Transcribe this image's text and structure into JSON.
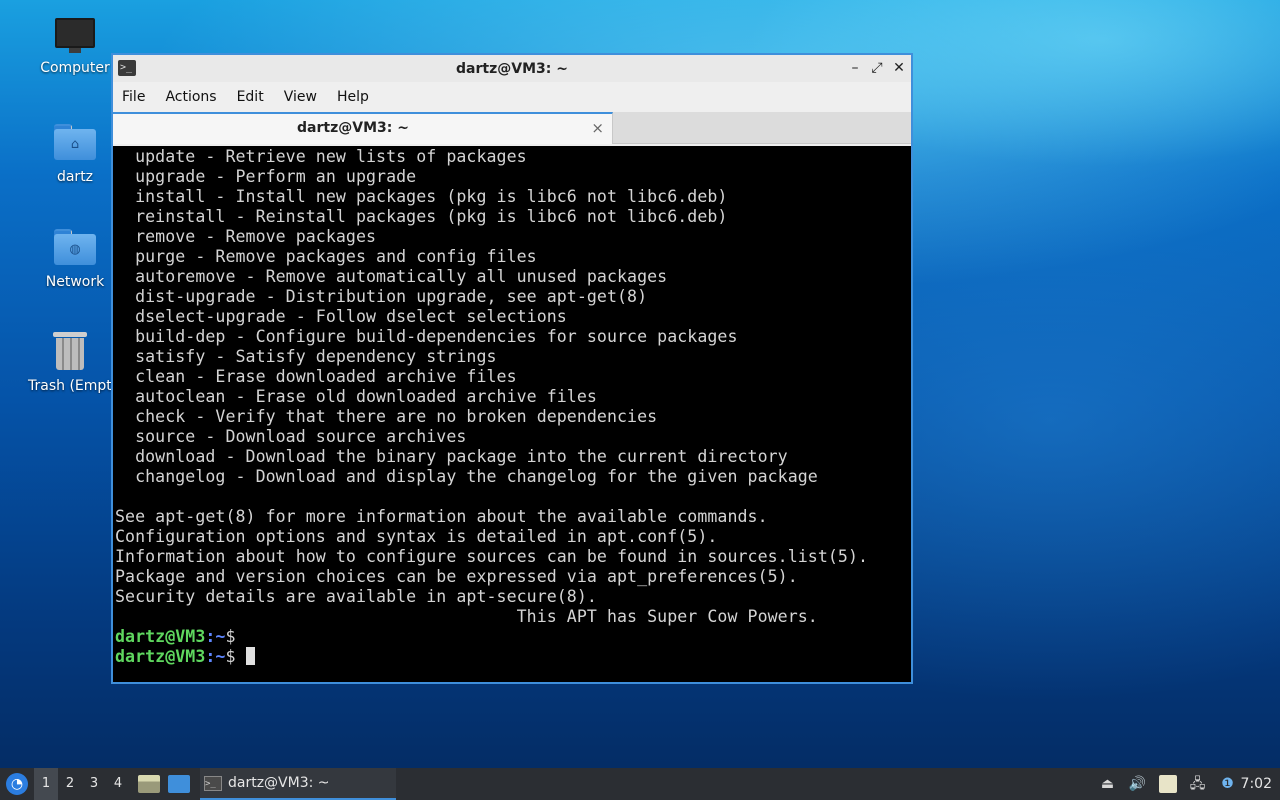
{
  "desktop": {
    "icons": [
      {
        "label": "Computer",
        "icon": "monitor-icon"
      },
      {
        "label": "dartz",
        "icon": "home-folder-icon"
      },
      {
        "label": "Network",
        "icon": "network-folder-icon"
      },
      {
        "label": "Trash (Empt",
        "icon": "trash-icon"
      }
    ]
  },
  "window": {
    "title": "dartz@VM3: ~",
    "menu": [
      "File",
      "Actions",
      "Edit",
      "View",
      "Help"
    ],
    "tab_label": "dartz@VM3: ~",
    "tab_close": "×",
    "controls": {
      "minimize": "–",
      "maximize": "⤢",
      "close": "✕"
    }
  },
  "terminal": {
    "lines": [
      "  update - Retrieve new lists of packages",
      "  upgrade - Perform an upgrade",
      "  install - Install new packages (pkg is libc6 not libc6.deb)",
      "  reinstall - Reinstall packages (pkg is libc6 not libc6.deb)",
      "  remove - Remove packages",
      "  purge - Remove packages and config files",
      "  autoremove - Remove automatically all unused packages",
      "  dist-upgrade - Distribution upgrade, see apt-get(8)",
      "  dselect-upgrade - Follow dselect selections",
      "  build-dep - Configure build-dependencies for source packages",
      "  satisfy - Satisfy dependency strings",
      "  clean - Erase downloaded archive files",
      "  autoclean - Erase old downloaded archive files",
      "  check - Verify that there are no broken dependencies",
      "  source - Download source archives",
      "  download - Download the binary package into the current directory",
      "  changelog - Download and display the changelog for the given package",
      "",
      "See apt-get(8) for more information about the available commands.",
      "Configuration options and syntax is detailed in apt.conf(5).",
      "Information about how to configure sources can be found in sources.list(5).",
      "Package and version choices can be expressed via apt_preferences(5).",
      "Security details are available in apt-secure(8).",
      "                                        This APT has Super Cow Powers."
    ],
    "prompt_user": "dartz@VM3",
    "prompt_path": ":~",
    "prompt_symbol": "$"
  },
  "taskbar": {
    "workspaces": [
      "1",
      "2",
      "3",
      "4"
    ],
    "active_workspace": "1",
    "task_label": "dartz@VM3: ~",
    "clock": "7:02"
  },
  "colors": {
    "accent": "#3f8fdb",
    "prompt_user": "#5fd75f",
    "prompt_path": "#5f87ff",
    "taskbar_bg": "#2b2e33"
  }
}
